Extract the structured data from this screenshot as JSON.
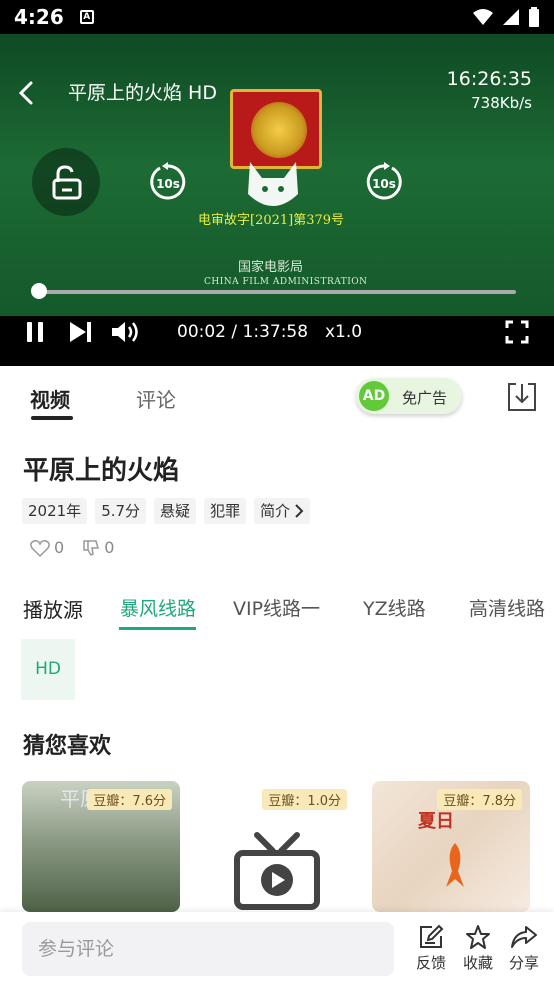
{
  "status_bar": {
    "time": "4:26",
    "notif": "A"
  },
  "player": {
    "title": "平原上的火焰 HD",
    "clock": "16:26:35",
    "speed": "738Kb/s",
    "license": "电审故字[2021]第379号",
    "film_admin_cn": "国家电影局",
    "film_admin_en": "CHINA FILM ADMINISTRATION",
    "rewind_label": "10s",
    "forward_label": "10s",
    "time": "00:02 / 1:37:58",
    "rate": "x1.0",
    "progress": 0.0003
  },
  "tabs": {
    "video": "视频",
    "comment": "评论",
    "ad_badge": "AD",
    "ad_free": "免广告"
  },
  "movie": {
    "title": "平原上的火焰",
    "tags": [
      "2021年",
      "5.7分",
      "悬疑",
      "犯罪"
    ],
    "intro": "简介",
    "likes": "0",
    "dislikes": "0"
  },
  "sources": {
    "label": "播放源",
    "items": [
      "暴风线路",
      "VIP线路一",
      "YZ线路",
      "高清线路"
    ]
  },
  "episode": "HD",
  "recommend": {
    "title": "猜您喜欢",
    "cards": [
      {
        "score": "豆瓣：7.6分",
        "poster": "平原上"
      },
      {
        "score": "豆瓣：1.0分",
        "poster": ""
      },
      {
        "score": "豆瓣：7.8分",
        "poster": "夏日"
      }
    ]
  },
  "bottom": {
    "placeholder": "参与评论",
    "feedback": "反馈",
    "favorite": "收藏",
    "share": "分享"
  },
  "colors": {
    "accent": "#1fa97a",
    "ad_green": "#62c93b"
  }
}
